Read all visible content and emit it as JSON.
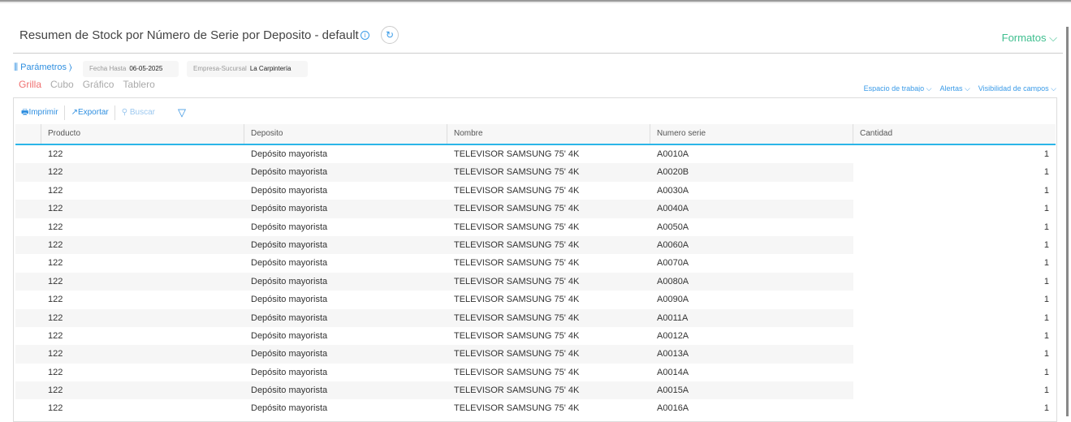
{
  "header": {
    "title": "Resumen de Stock por Número de Serie por Deposito - default",
    "formatos": "Formatos ⌵"
  },
  "params": {
    "label": "Parámetros ⟩",
    "fecha_label": "Fecha Hasta",
    "fecha_value": "06-05-2025",
    "empresa_label": "Empresa-Sucursal",
    "empresa_value": "La Carpintería"
  },
  "views": [
    "Grilla",
    "Cubo",
    "Gráfico",
    "Tablero"
  ],
  "right_links": [
    "Espacio de trabajo ⌵",
    "Alertas ⌵",
    "Visibilidad de campos ⌵"
  ],
  "toolbar": {
    "print": "Imprimir",
    "export": "Exportar",
    "search": "Buscar"
  },
  "columns": [
    "Producto",
    "Deposito",
    "Nombre",
    "Numero serie",
    "Cantidad"
  ],
  "rows": [
    [
      "122",
      "Depósito mayorista",
      "TELEVISOR SAMSUNG 75' 4K",
      "A0010A",
      "1"
    ],
    [
      "122",
      "Depósito mayorista",
      "TELEVISOR SAMSUNG 75' 4K",
      "A0020B",
      "1"
    ],
    [
      "122",
      "Depósito mayorista",
      "TELEVISOR SAMSUNG 75' 4K",
      "A0030A",
      "1"
    ],
    [
      "122",
      "Depósito mayorista",
      "TELEVISOR SAMSUNG 75' 4K",
      "A0040A",
      "1"
    ],
    [
      "122",
      "Depósito mayorista",
      "TELEVISOR SAMSUNG 75' 4K",
      "A0050A",
      "1"
    ],
    [
      "122",
      "Depósito mayorista",
      "TELEVISOR SAMSUNG 75' 4K",
      "A0060A",
      "1"
    ],
    [
      "122",
      "Depósito mayorista",
      "TELEVISOR SAMSUNG 75' 4K",
      "A0070A",
      "1"
    ],
    [
      "122",
      "Depósito mayorista",
      "TELEVISOR SAMSUNG 75' 4K",
      "A0080A",
      "1"
    ],
    [
      "122",
      "Depósito mayorista",
      "TELEVISOR SAMSUNG 75' 4K",
      "A0090A",
      "1"
    ],
    [
      "122",
      "Depósito mayorista",
      "TELEVISOR SAMSUNG 75' 4K",
      "A0011A",
      "1"
    ],
    [
      "122",
      "Depósito mayorista",
      "TELEVISOR SAMSUNG 75' 4K",
      "A0012A",
      "1"
    ],
    [
      "122",
      "Depósito mayorista",
      "TELEVISOR SAMSUNG 75' 4K",
      "A0013A",
      "1"
    ],
    [
      "122",
      "Depósito mayorista",
      "TELEVISOR SAMSUNG 75' 4K",
      "A0014A",
      "1"
    ],
    [
      "122",
      "Depósito mayorista",
      "TELEVISOR SAMSUNG 75' 4K",
      "A0015A",
      "1"
    ],
    [
      "122",
      "Depósito mayorista",
      "TELEVISOR SAMSUNG 75' 4K",
      "A0016A",
      "1"
    ]
  ]
}
